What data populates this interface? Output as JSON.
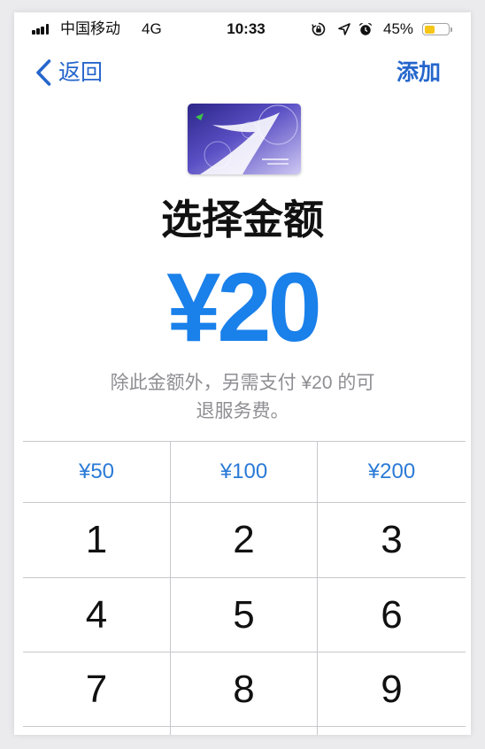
{
  "status_bar": {
    "carrier": "中国移动",
    "network": "4G",
    "time": "10:33",
    "battery_percent": "45%",
    "battery_level": 45,
    "icons": [
      "signal-icon",
      "rotation-lock-icon",
      "location-icon",
      "alarm-icon",
      "battery-icon"
    ]
  },
  "nav": {
    "back_label": "返回",
    "add_label": "添加",
    "back_icon": "chevron-left-icon"
  },
  "card": {
    "icon": "transit-card-image"
  },
  "title": "选择金额",
  "amount": "¥20",
  "description_lines": [
    "除此金额外，另需支付 ¥20 的可",
    "退服务费。"
  ],
  "presets": [
    "¥50",
    "¥100",
    "¥200"
  ],
  "keypad": [
    [
      "1",
      "2",
      "3"
    ],
    [
      "4",
      "5",
      "6"
    ],
    [
      "7",
      "8",
      "9"
    ]
  ],
  "colors": {
    "accent": "#2566cc",
    "amount": "#1a80ea",
    "preset": "#2a7ad6",
    "battery": "#f5c518",
    "text_secondary": "#8e8e93"
  }
}
